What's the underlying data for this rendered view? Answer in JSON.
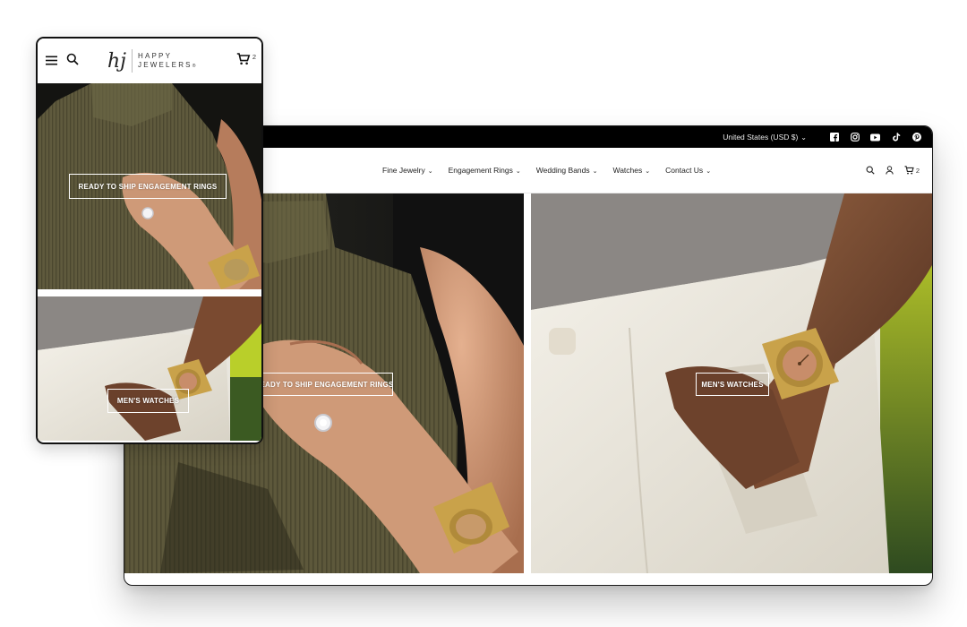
{
  "desktop": {
    "topbar": {
      "currency": "United States (USD $)",
      "socials": [
        "facebook-icon",
        "instagram-icon",
        "youtube-icon",
        "tiktok-icon",
        "pinterest-icon"
      ]
    },
    "nav": {
      "menu": [
        "Fine Jewelry",
        "Engagement Rings",
        "Wedding Bands",
        "Watches",
        "Contact Us"
      ],
      "cart_count": "2"
    },
    "hero": {
      "left_cta": "READY TO SHIP ENGAGEMENT RINGS",
      "right_cta": "MEN'S WATCHES"
    }
  },
  "mobile": {
    "logo": {
      "monogram": "hj",
      "line1": "HAPPY",
      "line2": "JEWELERS",
      "mark": "®"
    },
    "cart_count": "2",
    "cta_top": "READY TO SHIP ENGAGEMENT RINGS",
    "cta_bottom": "MEN'S WATCHES"
  },
  "colors": {
    "topbar": "#000000",
    "sweater": "#5f5a3d",
    "shirt": "#8b8784",
    "pants": "#eeebe3",
    "gold": "#c9a24a",
    "foliage": "#d7e21a"
  }
}
